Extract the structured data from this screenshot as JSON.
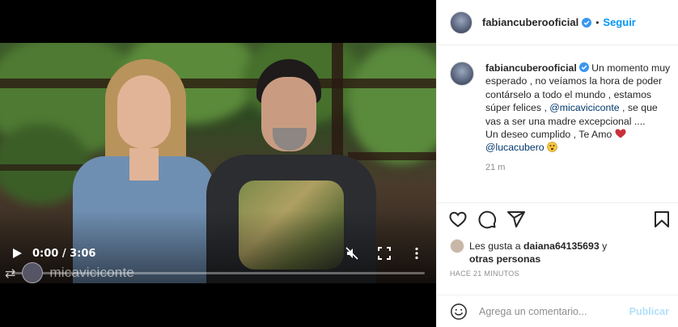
{
  "post": {
    "author": "fabiancuberooficial",
    "follow_label": "Seguir",
    "separator": "•"
  },
  "video": {
    "time": "0:00 / 3:06",
    "progress": 0,
    "overlay_username": "micaviciconte"
  },
  "caption": {
    "author": "fabiancuberooficial",
    "text_part1": " Un momento muy esperado , no veíamos la hora de poder contárselo a todo el mundo , estamos súper felices , ",
    "mention1": "@micaviciconte",
    "text_part2": " , se que vas a ser una madre excepcional ....",
    "text_part3": "Un deseo cumplido , Te Amo ",
    "mention2": "@lucacubero",
    "time_ago": "21 m"
  },
  "likes": {
    "prefix": "Les gusta a ",
    "user": "daiana64135693",
    "middle": " y ",
    "suffix": "otras personas"
  },
  "posted_ago": "HACE 21 MINUTOS",
  "comment": {
    "placeholder": "Agrega un comentario...",
    "publish_label": "Publicar"
  },
  "colors": {
    "accent": "#0095f6",
    "mention": "#00376b",
    "muted": "#8e8e8e",
    "publish_disabled": "#b2dffc",
    "verified": "#3897f0",
    "heart": "#c9303a"
  },
  "icons": [
    "verified-icon",
    "heart-icon",
    "comment-icon",
    "share-icon",
    "bookmark-icon",
    "emoji-icon",
    "play-icon",
    "mute-icon",
    "fullscreen-icon",
    "more-icon",
    "repost-icon"
  ]
}
